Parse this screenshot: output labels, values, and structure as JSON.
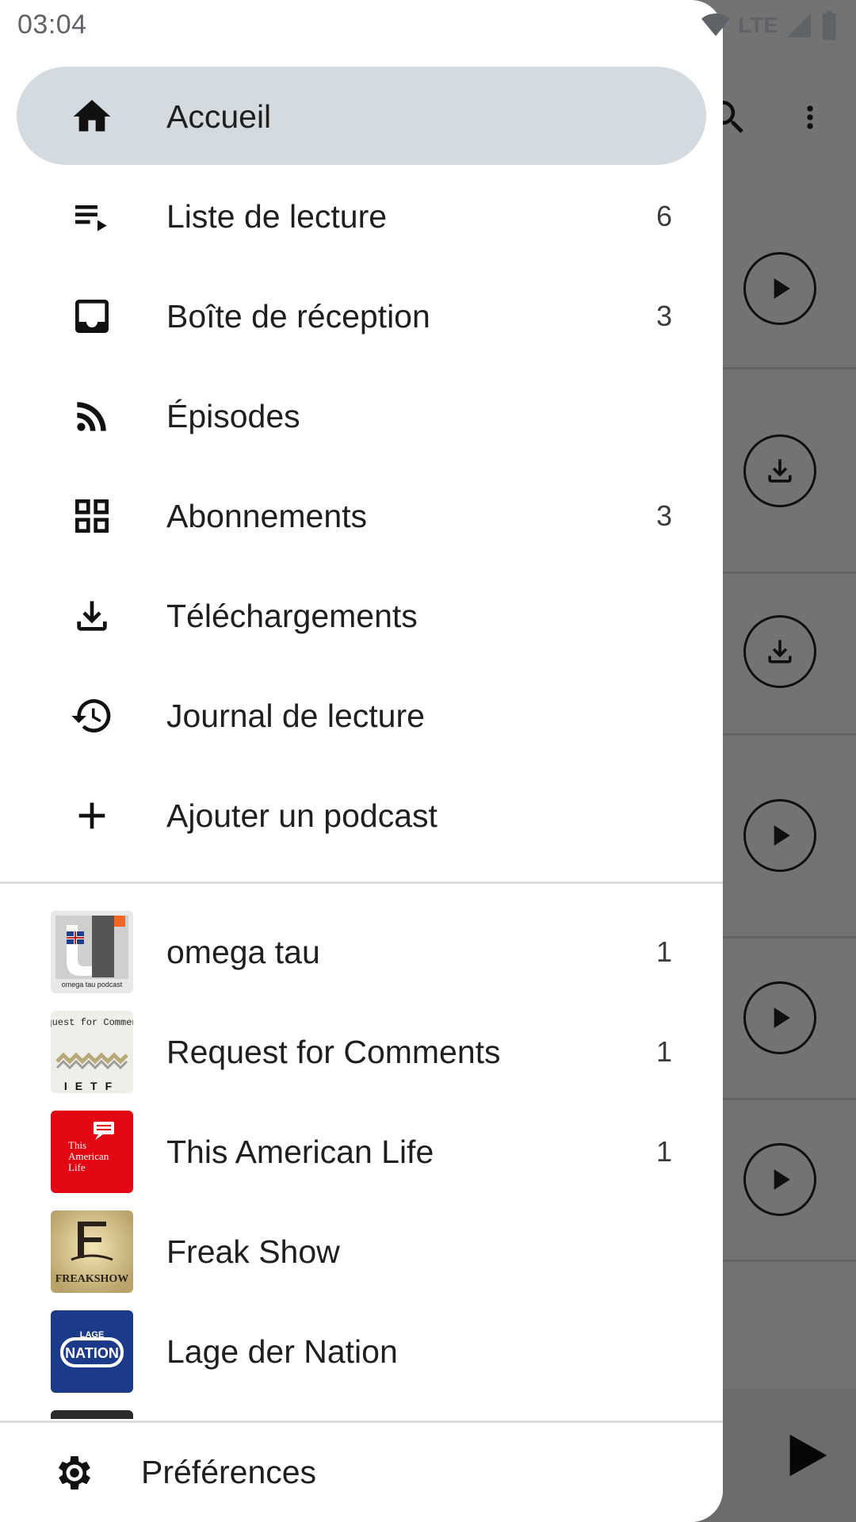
{
  "status_bar": {
    "time": "03:04",
    "network": "LTE"
  },
  "drawer": {
    "nav_items": [
      {
        "label": "Accueil",
        "count": "",
        "icon": "home-icon",
        "active": true
      },
      {
        "label": "Liste de lecture",
        "count": "6",
        "icon": "playlist-icon"
      },
      {
        "label": "Boîte de réception",
        "count": "3",
        "icon": "inbox-icon"
      },
      {
        "label": "Épisodes",
        "count": "",
        "icon": "rss-icon"
      },
      {
        "label": "Abonnements",
        "count": "3",
        "icon": "grid-icon"
      },
      {
        "label": "Téléchargements",
        "count": "",
        "icon": "download-icon"
      },
      {
        "label": "Journal de lecture",
        "count": "",
        "icon": "history-icon"
      },
      {
        "label": "Ajouter un podcast",
        "count": "",
        "icon": "plus-icon"
      }
    ],
    "subscriptions": [
      {
        "name": "omega tau",
        "count": "1",
        "cover_text": "omega tau podcast"
      },
      {
        "name": "Request for Comments",
        "count": "1",
        "cover_text": "Request for Comments"
      },
      {
        "name": "This American Life",
        "count": "1",
        "cover_text": "This American Life"
      },
      {
        "name": "Freak Show",
        "count": "",
        "cover_text": "FREAKSHOW"
      },
      {
        "name": "Lage der Nation",
        "count": "",
        "cover_text": "LAGE NATION"
      }
    ],
    "footer": {
      "label": "Préférences",
      "icon": "gear-icon"
    }
  },
  "colors": {
    "active_pill": "#d3dbe0",
    "tal_red": "#e30613",
    "lage_blue": "#1b3a8a"
  }
}
